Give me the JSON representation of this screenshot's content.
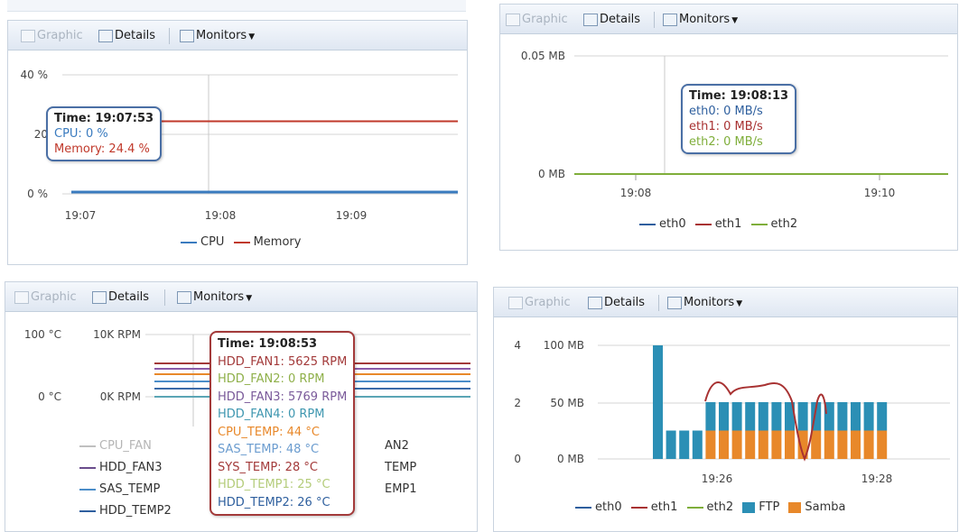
{
  "toolbar": {
    "graphic": "Graphic",
    "details": "Details",
    "monitors": "Monitors"
  },
  "panel1": {
    "y_labels": [
      "40 %",
      "20",
      "0 %"
    ],
    "x_labels": [
      "19:07",
      "19:08",
      "19:09"
    ],
    "tooltip": {
      "time": "Time: 19:07:53",
      "cpu": "CPU: 0 %",
      "memory": "Memory: 24.4 %"
    },
    "legend": [
      "CPU",
      "Memory"
    ]
  },
  "panel2": {
    "y_labels": [
      "0.05 MB",
      "0 MB"
    ],
    "x_labels": [
      "19:08",
      "19:10"
    ],
    "tooltip": {
      "time": "Time: 19:08:13",
      "eth0": "eth0: 0 MB/s",
      "eth1": "eth1: 0 MB/s",
      "eth2": "eth2: 0 MB/s"
    },
    "legend": [
      "eth0",
      "eth1",
      "eth2"
    ]
  },
  "panel3": {
    "y_left": [
      "100 °C",
      "0 °C"
    ],
    "y_right": [
      "10K RPM",
      "0K RPM"
    ],
    "tooltip": {
      "time": "Time: 19:08:53",
      "lines": [
        "HDD_FAN1: 5625 RPM",
        "HDD_FAN2: 0 RPM",
        "HDD_FAN3: 5769 RPM",
        "HDD_FAN4: 0 RPM",
        "CPU_TEMP: 44 °C",
        "SAS_TEMP: 48 °C",
        "SYS_TEMP: 28 °C",
        "HDD_TEMP1: 25 °C",
        "HDD_TEMP2: 26 °C"
      ]
    },
    "legend_left": [
      "CPU_FAN",
      "HDD_FAN3",
      "SAS_TEMP",
      "HDD_TEMP2"
    ],
    "legend_right": [
      "AN2",
      "TEMP",
      "EMP1"
    ]
  },
  "panel4": {
    "y_left": [
      "4",
      "2",
      "0"
    ],
    "y_right": [
      "100 MB",
      "50 MB",
      "0 MB"
    ],
    "x_labels": [
      "19:26",
      "19:28"
    ],
    "legend": [
      "eth0",
      "eth1",
      "eth2",
      "FTP",
      "Samba"
    ]
  },
  "colors": {
    "cpu": "#3a7bbf",
    "memory": "#c0392b",
    "eth0": "#2e5f9e",
    "eth1": "#a83232",
    "eth2": "#7fae3a",
    "ftp": "#2b8fb5",
    "samba": "#e8882a",
    "tooltip_border_blue": "#4a6fa5",
    "tooltip_border_red": "#a33a3a"
  },
  "chart_data": [
    {
      "type": "line",
      "x": [
        "19:07",
        "19:08",
        "19:09"
      ],
      "ylim": [
        0,
        40
      ],
      "series": [
        {
          "name": "CPU",
          "values": [
            0,
            0,
            0
          ]
        },
        {
          "name": "Memory",
          "values": [
            24.4,
            24.4,
            24.4
          ]
        }
      ]
    },
    {
      "type": "line",
      "x": [
        "19:08",
        "19:10"
      ],
      "ylim": [
        0,
        0.05
      ],
      "series": [
        {
          "name": "eth0",
          "values": [
            0,
            0
          ]
        },
        {
          "name": "eth1",
          "values": [
            0,
            0
          ]
        },
        {
          "name": "eth2",
          "values": [
            0,
            0
          ]
        }
      ]
    },
    {
      "type": "line",
      "series": [
        {
          "name": "HDD_FAN1",
          "values": [
            5625
          ]
        },
        {
          "name": "HDD_FAN2",
          "values": [
            0
          ]
        },
        {
          "name": "HDD_FAN3",
          "values": [
            5769
          ]
        },
        {
          "name": "HDD_FAN4",
          "values": [
            0
          ]
        },
        {
          "name": "CPU_TEMP",
          "values": [
            44
          ]
        },
        {
          "name": "SAS_TEMP",
          "values": [
            48
          ]
        },
        {
          "name": "SYS_TEMP",
          "values": [
            28
          ]
        },
        {
          "name": "HDD_TEMP1",
          "values": [
            25
          ]
        },
        {
          "name": "HDD_TEMP2",
          "values": [
            26
          ]
        }
      ]
    },
    {
      "type": "bar",
      "ylim": [
        0,
        4
      ],
      "series": [
        {
          "name": "FTP",
          "values": [
            4,
            1,
            1,
            1,
            2,
            2,
            2,
            2,
            2,
            2,
            2,
            2,
            2,
            2,
            2,
            2,
            2,
            2
          ]
        },
        {
          "name": "Samba",
          "values": [
            0,
            0,
            0,
            0,
            1,
            1,
            1,
            1,
            1,
            1,
            1,
            1,
            1,
            1,
            1,
            1,
            1,
            1
          ]
        }
      ]
    }
  ]
}
